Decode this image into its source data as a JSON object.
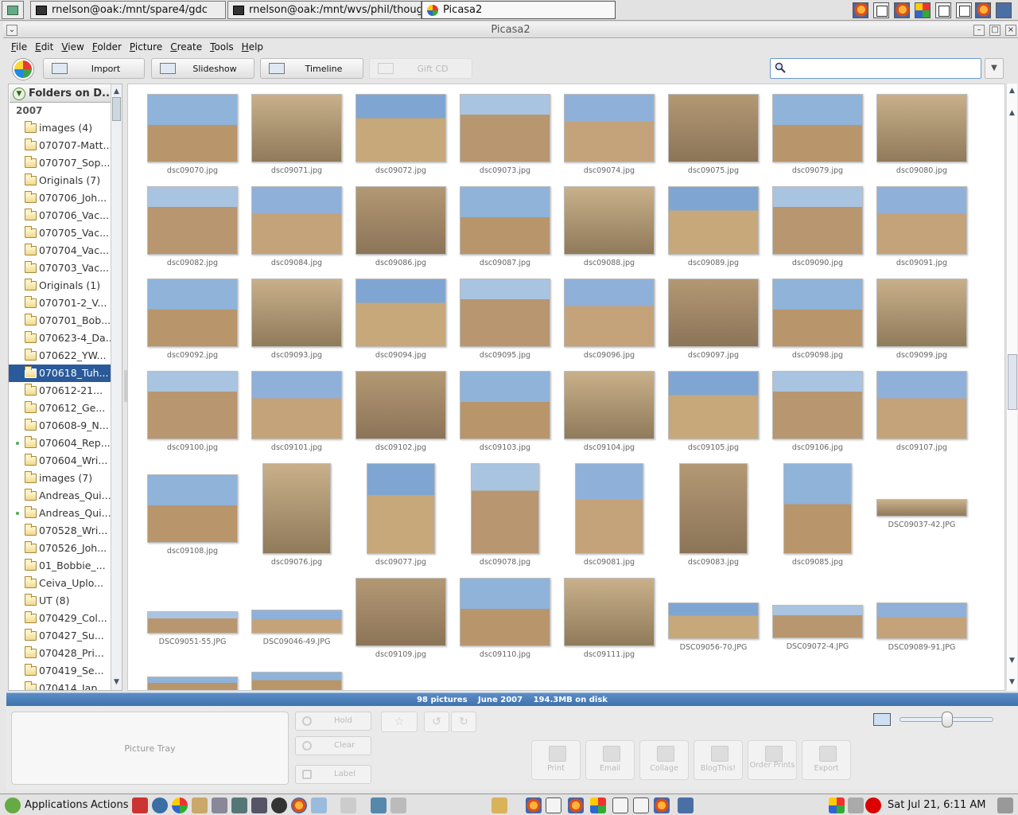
{
  "taskbar": {
    "tasks": [
      "rnelson@oak:/mnt/spare4/gdc",
      "rnelson@oak:/mnt/wvs/phil/thoughtlet",
      "Picasa2"
    ]
  },
  "window": {
    "title": "Picasa2"
  },
  "menu": [
    "File",
    "Edit",
    "View",
    "Folder",
    "Picture",
    "Create",
    "Tools",
    "Help"
  ],
  "toolbar": {
    "import": "Import",
    "slideshow": "Slideshow",
    "timeline": "Timeline",
    "giftcd": "Gift CD"
  },
  "search": {
    "value": ""
  },
  "sidebar": {
    "header": "Folders on D...",
    "year": "2007",
    "folders": [
      {
        "name": "images (4)"
      },
      {
        "name": "070707-Matt..."
      },
      {
        "name": "070707_Sop..."
      },
      {
        "name": "Originals (7)"
      },
      {
        "name": "070706_Joh..."
      },
      {
        "name": "070706_Vac..."
      },
      {
        "name": "070705_Vac..."
      },
      {
        "name": "070704_Vac..."
      },
      {
        "name": "070703_Vac..."
      },
      {
        "name": "Originals (1)"
      },
      {
        "name": "070701-2_V..."
      },
      {
        "name": "070701_Bob..."
      },
      {
        "name": "070623-4_Da..."
      },
      {
        "name": "070622_YW..."
      },
      {
        "name": "070618_Tuh...",
        "selected": true
      },
      {
        "name": "070612-21..."
      },
      {
        "name": "070612_Ge..."
      },
      {
        "name": "070608-9_N..."
      },
      {
        "name": "070604_Rep...",
        "dot": true
      },
      {
        "name": "070604_Wri..."
      },
      {
        "name": "images (7)"
      },
      {
        "name": "Andreas_Qui..."
      },
      {
        "name": "Andreas_Qui...",
        "dot": true
      },
      {
        "name": "070528_Wri..."
      },
      {
        "name": "070526_Joh..."
      },
      {
        "name": "01_Bobbie_..."
      },
      {
        "name": "Ceiva_Uplo..."
      },
      {
        "name": "UT (8)"
      },
      {
        "name": "070429_Col..."
      },
      {
        "name": "070427_Su..."
      },
      {
        "name": "070428_Pri..."
      },
      {
        "name": "070419_Se..."
      },
      {
        "name": "070414_Jap..."
      }
    ]
  },
  "photos": {
    "row1": [
      "dsc09070.jpg",
      "dsc09071.jpg",
      "dsc09072.jpg",
      "dsc09073.jpg",
      "dsc09074.jpg",
      "dsc09075.jpg",
      "dsc09079.jpg",
      "dsc09080.jpg"
    ],
    "row2": [
      "dsc09082.jpg",
      "dsc09084.jpg",
      "dsc09086.jpg",
      "dsc09087.jpg",
      "dsc09088.jpg",
      "dsc09089.jpg",
      "dsc09090.jpg",
      "dsc09091.jpg"
    ],
    "row3": [
      "dsc09092.jpg",
      "dsc09093.jpg",
      "dsc09094.jpg",
      "dsc09095.jpg",
      "dsc09096.jpg",
      "dsc09097.jpg",
      "dsc09098.jpg",
      "dsc09099.jpg"
    ],
    "row4": [
      "dsc09100.jpg",
      "dsc09101.jpg",
      "dsc09102.jpg",
      "dsc09103.jpg",
      "dsc09104.jpg",
      "dsc09105.jpg",
      "dsc09106.jpg",
      "dsc09107.jpg"
    ],
    "row5": [
      "dsc09108.jpg",
      "dsc09076.jpg",
      "dsc09077.jpg",
      "dsc09078.jpg",
      "dsc09081.jpg",
      "dsc09083.jpg",
      "dsc09085.jpg",
      "DSC09037-42.JPG"
    ],
    "row6": [
      "DSC09051-55.JPG",
      "DSC09046-49.JPG",
      "dsc09109.jpg",
      "dsc09110.jpg",
      "dsc09111.jpg",
      "DSC09056-70.JPG",
      "DSC09072-4.JPG",
      "DSC09089-91.JPG"
    ]
  },
  "status": {
    "count": "98 pictures",
    "date": "June 2007",
    "size": "194.3MB on disk"
  },
  "tray": {
    "label": "Picture Tray",
    "hold": "Hold",
    "clear": "Clear",
    "tag": "Label",
    "actions": [
      "Print",
      "Email",
      "Collage",
      "BlogThis!",
      "Order Prints",
      "Export"
    ]
  },
  "os": {
    "applications": "Applications",
    "actions": "Actions",
    "clock": "Sat Jul 21,  6:11 AM"
  }
}
